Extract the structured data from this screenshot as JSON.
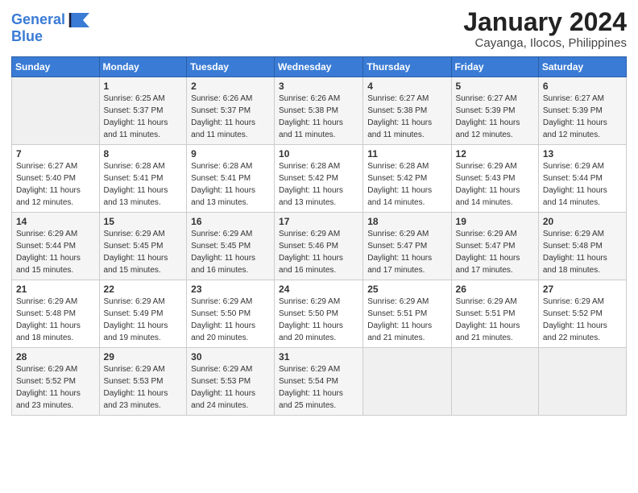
{
  "logo": {
    "line1": "General",
    "line2": "Blue"
  },
  "title": "January 2024",
  "location": "Cayanga, Ilocos, Philippines",
  "days_header": [
    "Sunday",
    "Monday",
    "Tuesday",
    "Wednesday",
    "Thursday",
    "Friday",
    "Saturday"
  ],
  "weeks": [
    [
      {
        "day": "",
        "info": ""
      },
      {
        "day": "1",
        "info": "Sunrise: 6:25 AM\nSunset: 5:37 PM\nDaylight: 11 hours\nand 11 minutes."
      },
      {
        "day": "2",
        "info": "Sunrise: 6:26 AM\nSunset: 5:37 PM\nDaylight: 11 hours\nand 11 minutes."
      },
      {
        "day": "3",
        "info": "Sunrise: 6:26 AM\nSunset: 5:38 PM\nDaylight: 11 hours\nand 11 minutes."
      },
      {
        "day": "4",
        "info": "Sunrise: 6:27 AM\nSunset: 5:38 PM\nDaylight: 11 hours\nand 11 minutes."
      },
      {
        "day": "5",
        "info": "Sunrise: 6:27 AM\nSunset: 5:39 PM\nDaylight: 11 hours\nand 12 minutes."
      },
      {
        "day": "6",
        "info": "Sunrise: 6:27 AM\nSunset: 5:39 PM\nDaylight: 11 hours\nand 12 minutes."
      }
    ],
    [
      {
        "day": "7",
        "info": "Sunrise: 6:27 AM\nSunset: 5:40 PM\nDaylight: 11 hours\nand 12 minutes."
      },
      {
        "day": "8",
        "info": "Sunrise: 6:28 AM\nSunset: 5:41 PM\nDaylight: 11 hours\nand 13 minutes."
      },
      {
        "day": "9",
        "info": "Sunrise: 6:28 AM\nSunset: 5:41 PM\nDaylight: 11 hours\nand 13 minutes."
      },
      {
        "day": "10",
        "info": "Sunrise: 6:28 AM\nSunset: 5:42 PM\nDaylight: 11 hours\nand 13 minutes."
      },
      {
        "day": "11",
        "info": "Sunrise: 6:28 AM\nSunset: 5:42 PM\nDaylight: 11 hours\nand 14 minutes."
      },
      {
        "day": "12",
        "info": "Sunrise: 6:29 AM\nSunset: 5:43 PM\nDaylight: 11 hours\nand 14 minutes."
      },
      {
        "day": "13",
        "info": "Sunrise: 6:29 AM\nSunset: 5:44 PM\nDaylight: 11 hours\nand 14 minutes."
      }
    ],
    [
      {
        "day": "14",
        "info": "Sunrise: 6:29 AM\nSunset: 5:44 PM\nDaylight: 11 hours\nand 15 minutes."
      },
      {
        "day": "15",
        "info": "Sunrise: 6:29 AM\nSunset: 5:45 PM\nDaylight: 11 hours\nand 15 minutes."
      },
      {
        "day": "16",
        "info": "Sunrise: 6:29 AM\nSunset: 5:45 PM\nDaylight: 11 hours\nand 16 minutes."
      },
      {
        "day": "17",
        "info": "Sunrise: 6:29 AM\nSunset: 5:46 PM\nDaylight: 11 hours\nand 16 minutes."
      },
      {
        "day": "18",
        "info": "Sunrise: 6:29 AM\nSunset: 5:47 PM\nDaylight: 11 hours\nand 17 minutes."
      },
      {
        "day": "19",
        "info": "Sunrise: 6:29 AM\nSunset: 5:47 PM\nDaylight: 11 hours\nand 17 minutes."
      },
      {
        "day": "20",
        "info": "Sunrise: 6:29 AM\nSunset: 5:48 PM\nDaylight: 11 hours\nand 18 minutes."
      }
    ],
    [
      {
        "day": "21",
        "info": "Sunrise: 6:29 AM\nSunset: 5:48 PM\nDaylight: 11 hours\nand 18 minutes."
      },
      {
        "day": "22",
        "info": "Sunrise: 6:29 AM\nSunset: 5:49 PM\nDaylight: 11 hours\nand 19 minutes."
      },
      {
        "day": "23",
        "info": "Sunrise: 6:29 AM\nSunset: 5:50 PM\nDaylight: 11 hours\nand 20 minutes."
      },
      {
        "day": "24",
        "info": "Sunrise: 6:29 AM\nSunset: 5:50 PM\nDaylight: 11 hours\nand 20 minutes."
      },
      {
        "day": "25",
        "info": "Sunrise: 6:29 AM\nSunset: 5:51 PM\nDaylight: 11 hours\nand 21 minutes."
      },
      {
        "day": "26",
        "info": "Sunrise: 6:29 AM\nSunset: 5:51 PM\nDaylight: 11 hours\nand 21 minutes."
      },
      {
        "day": "27",
        "info": "Sunrise: 6:29 AM\nSunset: 5:52 PM\nDaylight: 11 hours\nand 22 minutes."
      }
    ],
    [
      {
        "day": "28",
        "info": "Sunrise: 6:29 AM\nSunset: 5:52 PM\nDaylight: 11 hours\nand 23 minutes."
      },
      {
        "day": "29",
        "info": "Sunrise: 6:29 AM\nSunset: 5:53 PM\nDaylight: 11 hours\nand 23 minutes."
      },
      {
        "day": "30",
        "info": "Sunrise: 6:29 AM\nSunset: 5:53 PM\nDaylight: 11 hours\nand 24 minutes."
      },
      {
        "day": "31",
        "info": "Sunrise: 6:29 AM\nSunset: 5:54 PM\nDaylight: 11 hours\nand 25 minutes."
      },
      {
        "day": "",
        "info": ""
      },
      {
        "day": "",
        "info": ""
      },
      {
        "day": "",
        "info": ""
      }
    ]
  ]
}
